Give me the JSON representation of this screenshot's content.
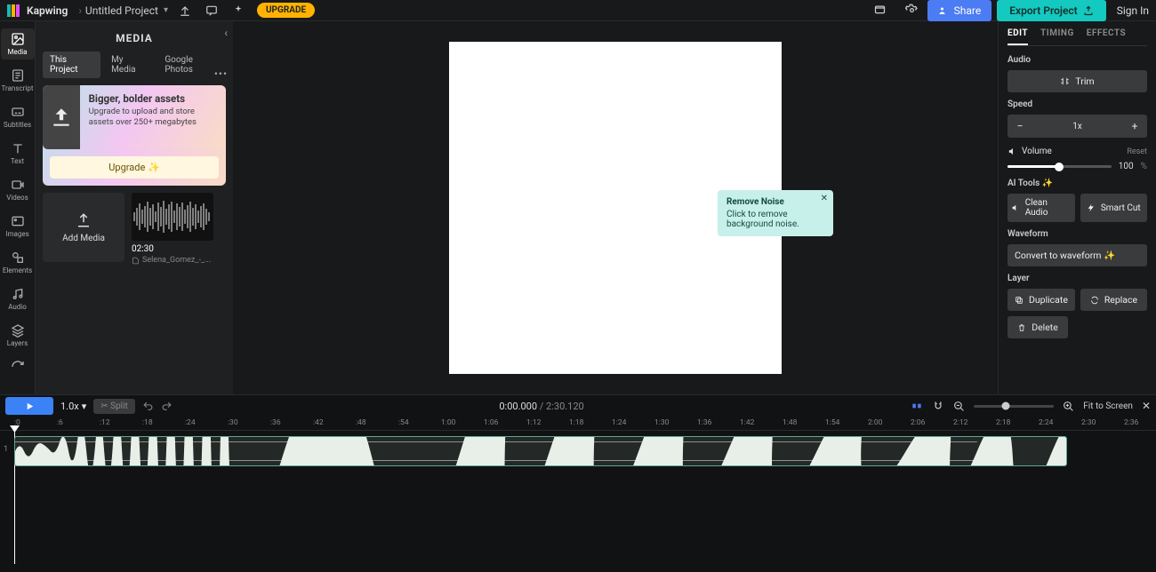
{
  "header": {
    "brand": "Kapwing",
    "project": "Untitled Project",
    "upgrade": "UPGRADE",
    "share": "Share",
    "export": "Export Project",
    "signin": "Sign In"
  },
  "rail": {
    "items": [
      {
        "label": "Media",
        "active": true
      },
      {
        "label": "Transcript"
      },
      {
        "label": "Subtitles"
      },
      {
        "label": "Text"
      },
      {
        "label": "Videos"
      },
      {
        "label": "Images"
      },
      {
        "label": "Elements"
      },
      {
        "label": "Audio"
      },
      {
        "label": "Layers"
      }
    ]
  },
  "media": {
    "title": "MEDIA",
    "tabs": {
      "thisProject": "This Project",
      "myMedia": "My Media",
      "google": "Google Photos"
    },
    "promo": {
      "title": "Bigger, bolder assets",
      "sub": "Upgrade to upload and store assets over 250+ megabytes",
      "btn": "Upgrade ✨"
    },
    "add": "Add Media",
    "clip": {
      "duration": "02:30",
      "name": "Selena_Gomez_-_..."
    }
  },
  "tooltip": {
    "title": "Remove Noise",
    "body": "Click to remove background noise."
  },
  "right": {
    "tabs": {
      "edit": "EDIT",
      "timing": "TIMING",
      "effects": "EFFECTS"
    },
    "audio": "Audio",
    "trim": "Trim",
    "speed": "Speed",
    "speedVal": "1x",
    "volume": "Volume",
    "reset": "Reset",
    "volVal": "100",
    "pct": "%",
    "aiTools": "AI Tools ✨",
    "clean": "Clean Audio",
    "smart": "Smart Cut",
    "waveform": "Waveform",
    "convert": "Convert to waveform ✨",
    "layer": "Layer",
    "duplicate": "Duplicate",
    "replace": "Replace",
    "delete": "Delete"
  },
  "timeline": {
    "speed": "1.0x",
    "split": "✂ Split",
    "current": "0:00.000",
    "total": "2:30.120",
    "fit": "Fit to Screen",
    "ticks": [
      ":0",
      ":6",
      ":12",
      ":18",
      ":24",
      ":30",
      ":36",
      ":42",
      ":48",
      ":54",
      "1:00",
      "1:06",
      "1:12",
      "1:18",
      "1:24",
      "1:30",
      "1:36",
      "1:42",
      "1:48",
      "1:54",
      "2:00",
      "2:06",
      "2:12",
      "2:18",
      "2:24",
      "2:30",
      "2:36"
    ],
    "rowLabel": "1"
  }
}
